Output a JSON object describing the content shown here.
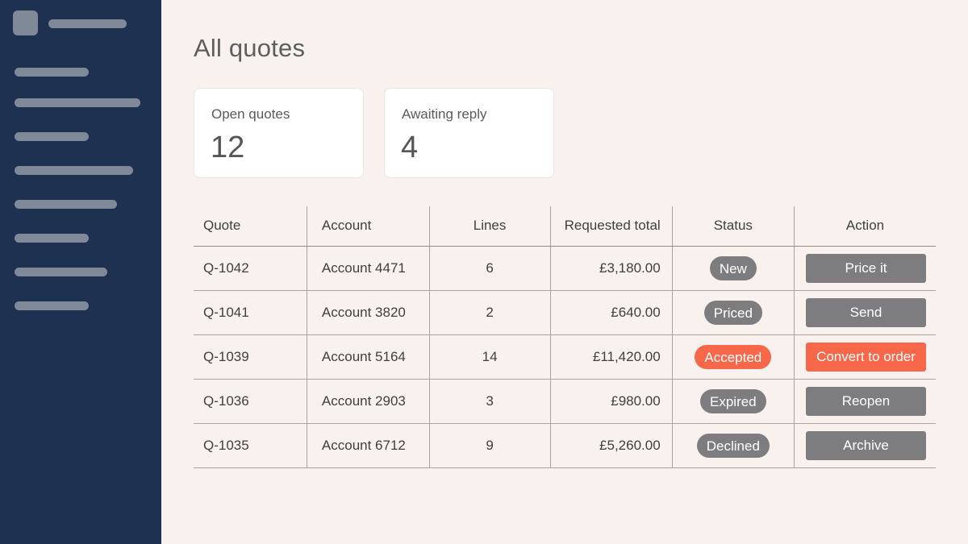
{
  "page": {
    "title": "All quotes"
  },
  "colors": {
    "sidebar": "#1f3150",
    "accent": "#f7684a",
    "neutral_badge": "#7d7d7f",
    "background": "#f8f1ee"
  },
  "stats": [
    {
      "label": "Open quotes",
      "value": "12"
    },
    {
      "label": "Awaiting reply",
      "value": "4"
    }
  ],
  "table": {
    "headers": [
      "Quote",
      "Account",
      "Lines",
      "Requested total",
      "Status",
      "Action"
    ],
    "rows": [
      {
        "quote": "Q-1042",
        "account": "Account 4471",
        "lines": "6",
        "total": "£3,180.00",
        "status": "New",
        "action": "Price it",
        "highlight": false
      },
      {
        "quote": "Q-1041",
        "account": "Account 3820",
        "lines": "2",
        "total": "£640.00",
        "status": "Priced",
        "action": "Send",
        "highlight": false
      },
      {
        "quote": "Q-1039",
        "account": "Account 5164",
        "lines": "14",
        "total": "£11,420.00",
        "status": "Accepted",
        "action": "Convert to order",
        "highlight": true
      },
      {
        "quote": "Q-1036",
        "account": "Account 2903",
        "lines": "3",
        "total": "£980.00",
        "status": "Expired",
        "action": "Reopen",
        "highlight": false
      },
      {
        "quote": "Q-1035",
        "account": "Account 6712",
        "lines": "9",
        "total": "£5,260.00",
        "status": "Declined",
        "action": "Archive",
        "highlight": false
      }
    ]
  }
}
